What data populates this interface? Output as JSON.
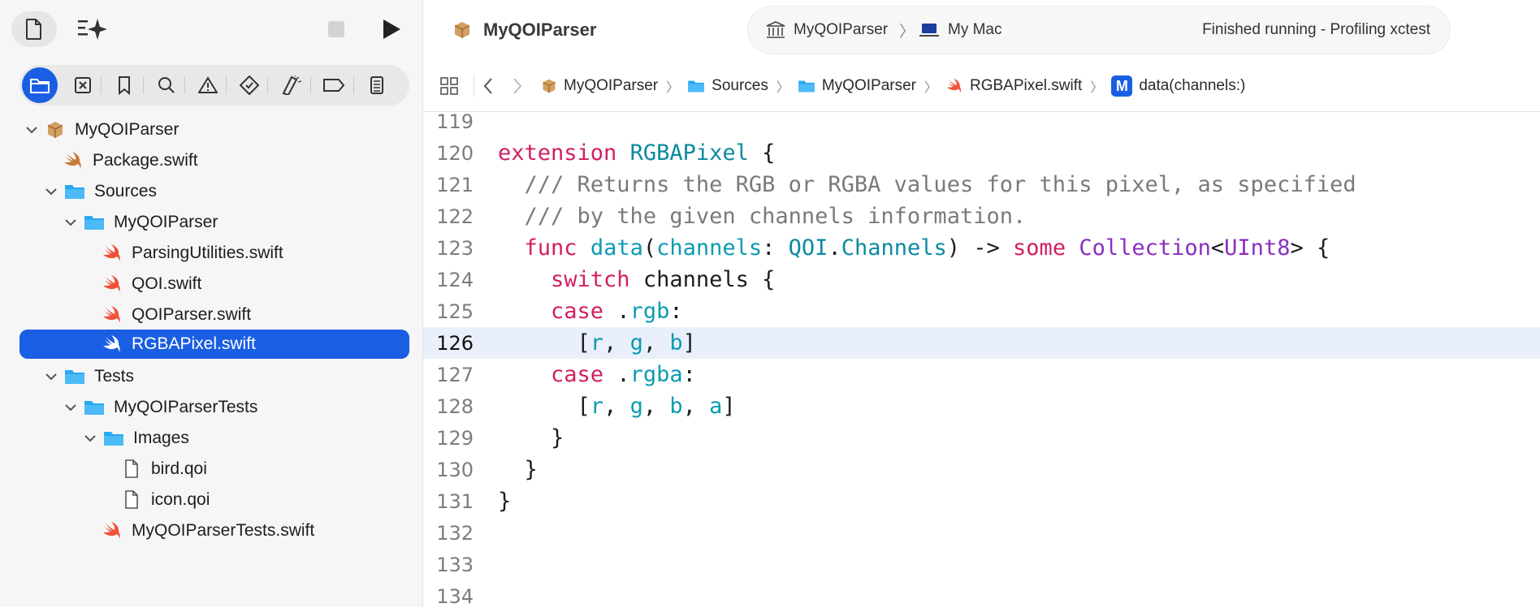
{
  "sidebar": {
    "tree": [
      {
        "label": "MyQOIParser",
        "kind": "package",
        "chevron": "down"
      },
      {
        "label": "Package.swift",
        "kind": "swift-file",
        "chevron": "none"
      },
      {
        "label": "Sources",
        "kind": "folder",
        "chevron": "down"
      },
      {
        "label": "MyQOIParser",
        "kind": "folder",
        "chevron": "down"
      },
      {
        "label": "ParsingUtilities.swift",
        "kind": "swift-file",
        "chevron": "none"
      },
      {
        "label": "QOI.swift",
        "kind": "swift-file",
        "chevron": "none"
      },
      {
        "label": "QOIParser.swift",
        "kind": "swift-file",
        "chevron": "none"
      },
      {
        "label": "RGBAPixel.swift",
        "kind": "swift-file",
        "chevron": "none",
        "selected": true
      },
      {
        "label": "Tests",
        "kind": "folder",
        "chevron": "down"
      },
      {
        "label": "MyQOIParserTests",
        "kind": "folder",
        "chevron": "down"
      },
      {
        "label": "Images",
        "kind": "folder",
        "chevron": "down"
      },
      {
        "label": "bird.qoi",
        "kind": "document",
        "chevron": "none"
      },
      {
        "label": "icon.qoi",
        "kind": "document",
        "chevron": "none"
      },
      {
        "label": "MyQOIParserTests.swift",
        "kind": "swift-file",
        "chevron": "none"
      }
    ],
    "nav_tabs": [
      "folder-icon",
      "source-control-icon",
      "bookmark-icon",
      "search-icon",
      "warning-icon",
      "test-icon",
      "debug-icon",
      "breakpoint-icon",
      "report-icon"
    ]
  },
  "toolbar": {
    "project_title": "MyQOIParser",
    "scheme": "MyQOIParser",
    "destination": "My Mac",
    "status": "Finished running - Profiling xctest"
  },
  "breadcrumbs": {
    "items": [
      "MyQOIParser",
      "Sources",
      "MyQOIParser",
      "RGBAPixel.swift",
      "data(channels:)"
    ],
    "method_badge": "M"
  },
  "editor": {
    "line_numbers": [
      "119",
      "120",
      "121",
      "122",
      "123",
      "124",
      "125",
      "126",
      "127",
      "128",
      "129",
      "130",
      "131",
      "132",
      "133",
      "134"
    ],
    "current_line": "126"
  },
  "colors": {
    "accent": "#1a5fe3",
    "keyword": "#d11f63",
    "type": "#0b8aa0",
    "type_other": "#8a2fc0",
    "comment": "#7a7a7a",
    "swift_orange": "#f05138",
    "folder_blue": "#2aa8f2"
  }
}
